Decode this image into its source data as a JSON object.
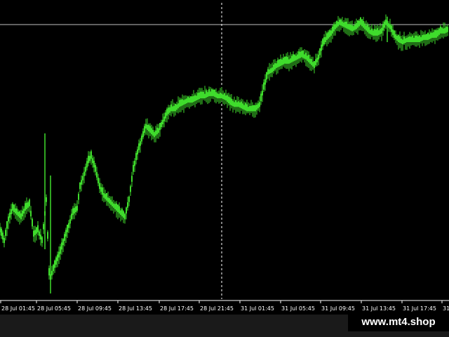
{
  "watermark": "www.mt4.shop",
  "colors": {
    "background": "#000000",
    "candle": "#3fdc2c",
    "crosshair": "#bfbfbf",
    "axis": "#ffffff",
    "bottom_strip": "#1a1a1a"
  },
  "chart_data": {
    "type": "line",
    "title": "",
    "xlabel": "",
    "ylabel": "",
    "x_ticks": [
      "28 Jul 01:45",
      "28 Jul 05:45",
      "28 Jul 09:45",
      "28 Jul 13:45",
      "28 Jul 17:45",
      "28 Jul 21:45",
      "31 Jul 01:45",
      "31 Jul 05:45",
      "31 Jul 09:45",
      "31 Jul 13:45",
      "31 Jul 17:45",
      "31"
    ],
    "ylim": [
      0,
      100
    ],
    "grid": false,
    "series": [
      {
        "style": "candlestick-envelope",
        "values": [
          [
            0,
            30
          ],
          [
            6,
            25
          ],
          [
            12,
            35
          ],
          [
            18,
            40
          ],
          [
            24,
            38
          ],
          [
            30,
            36
          ],
          [
            36,
            40
          ],
          [
            42,
            42
          ],
          [
            48,
            28
          ],
          [
            54,
            30
          ],
          [
            60,
            25
          ],
          [
            66,
            44
          ],
          [
            70,
            10
          ],
          [
            72,
            8
          ],
          [
            76,
            12
          ],
          [
            80,
            15
          ],
          [
            86,
            20
          ],
          [
            92,
            26
          ],
          [
            98,
            32
          ],
          [
            104,
            38
          ],
          [
            110,
            40
          ],
          [
            114,
            50
          ],
          [
            120,
            56
          ],
          [
            126,
            62
          ],
          [
            130,
            64
          ],
          [
            136,
            58
          ],
          [
            142,
            50
          ],
          [
            148,
            46
          ],
          [
            154,
            44
          ],
          [
            160,
            42
          ],
          [
            166,
            40
          ],
          [
            172,
            38
          ],
          [
            178,
            36
          ],
          [
            184,
            44
          ],
          [
            190,
            58
          ],
          [
            196,
            66
          ],
          [
            202,
            72
          ],
          [
            208,
            78
          ],
          [
            214,
            76
          ],
          [
            220,
            74
          ],
          [
            226,
            76
          ],
          [
            232,
            80
          ],
          [
            238,
            84
          ],
          [
            244,
            86
          ],
          [
            250,
            86
          ],
          [
            256,
            88
          ],
          [
            262,
            89
          ],
          [
            268,
            90
          ],
          [
            274,
            90
          ],
          [
            280,
            91
          ],
          [
            286,
            92
          ],
          [
            292,
            92
          ],
          [
            298,
            93
          ],
          [
            304,
            93
          ],
          [
            310,
            92
          ],
          [
            316,
            92
          ],
          [
            322,
            91
          ],
          [
            328,
            89
          ],
          [
            334,
            88
          ],
          [
            340,
            88
          ],
          [
            346,
            87
          ],
          [
            352,
            86
          ],
          [
            358,
            86
          ],
          [
            364,
            86
          ],
          [
            370,
            88
          ],
          [
            376,
            96
          ],
          [
            382,
            103
          ],
          [
            388,
            104
          ],
          [
            394,
            106
          ],
          [
            400,
            107
          ],
          [
            406,
            108
          ],
          [
            412,
            108
          ],
          [
            418,
            109
          ],
          [
            424,
            110
          ],
          [
            430,
            111
          ],
          [
            436,
            110
          ],
          [
            442,
            108
          ],
          [
            448,
            106
          ],
          [
            454,
            110
          ],
          [
            460,
            116
          ],
          [
            466,
            119
          ],
          [
            472,
            121
          ],
          [
            478,
            124
          ],
          [
            484,
            126
          ],
          [
            490,
            125
          ],
          [
            496,
            124
          ],
          [
            502,
            123
          ],
          [
            508,
            124
          ],
          [
            514,
            126
          ],
          [
            520,
            124
          ],
          [
            526,
            122
          ],
          [
            532,
            121
          ],
          [
            538,
            121
          ],
          [
            544,
            122
          ],
          [
            550,
            126
          ],
          [
            556,
            124
          ],
          [
            562,
            120
          ],
          [
            568,
            118
          ],
          [
            574,
            117
          ],
          [
            580,
            118
          ],
          [
            586,
            118
          ],
          [
            592,
            118
          ],
          [
            598,
            118
          ],
          [
            604,
            119
          ],
          [
            610,
            119
          ],
          [
            616,
            120
          ],
          [
            622,
            120
          ],
          [
            628,
            122
          ],
          [
            634,
            122
          ],
          [
            640,
            123
          ]
        ]
      }
    ]
  }
}
